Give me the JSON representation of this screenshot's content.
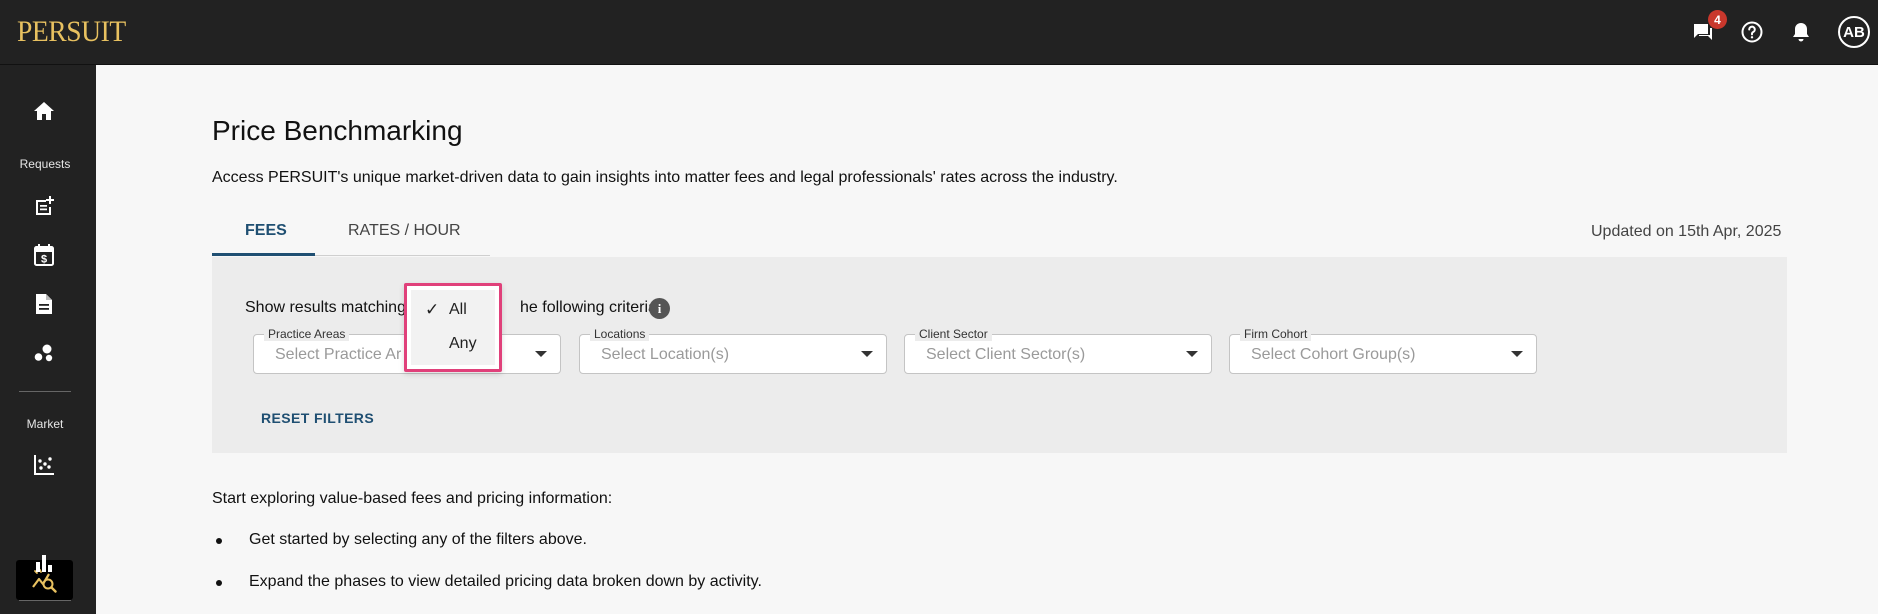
{
  "app": {
    "logo": "PERSUIT",
    "brand_color": "#e8c160",
    "accent_color": "#1f4f72",
    "highlight_color": "#e0407a"
  },
  "topbar": {
    "icons": [
      "messages-icon",
      "help-icon",
      "notifications-icon"
    ],
    "messages_badge": "4",
    "avatar_initials": "AB"
  },
  "sidebar": {
    "home_icon": "home-icon",
    "requests_label": "Requests",
    "requests_icons": [
      "new-request-icon",
      "calendar-dollar-icon",
      "document-icon",
      "network-icon"
    ],
    "market_label": "Market",
    "market_icons": [
      "scatter-chart-icon",
      "price-benchmark-icon",
      "bar-chart-icon"
    ],
    "active_item": "price-benchmark-icon"
  },
  "main": {
    "title": "Price Benchmarking",
    "description": "Access PERSUIT's unique market-driven data to gain insights into matter fees and legal professionals' rates across the industry.",
    "tabs": [
      {
        "label": "FEES",
        "active": true
      },
      {
        "label": "RATES / HOUR",
        "active": false
      }
    ],
    "updated": "Updated on 15th Apr, 2025"
  },
  "filters": {
    "criteria_prefix": "Show results matching",
    "criteria_suffix": "he following criteria",
    "selects": [
      {
        "label": "Practice Areas",
        "placeholder": "Select Practice Ar"
      },
      {
        "label": "Locations",
        "placeholder": "Select Location(s)"
      },
      {
        "label": "Client Sector",
        "placeholder": "Select Client Sector(s)"
      },
      {
        "label": "Firm Cohort",
        "placeholder": "Select Cohort Group(s)"
      }
    ],
    "reset_label": "RESET FILTERS",
    "match_dropdown": {
      "options": [
        {
          "label": "All",
          "selected": true
        },
        {
          "label": "Any",
          "selected": false
        }
      ]
    }
  },
  "content": {
    "intro": "Start exploring value-based fees and pricing information:",
    "bullets": [
      "Get started by selecting any of the filters above.",
      "Expand the phases to view detailed pricing data broken down by activity."
    ]
  }
}
